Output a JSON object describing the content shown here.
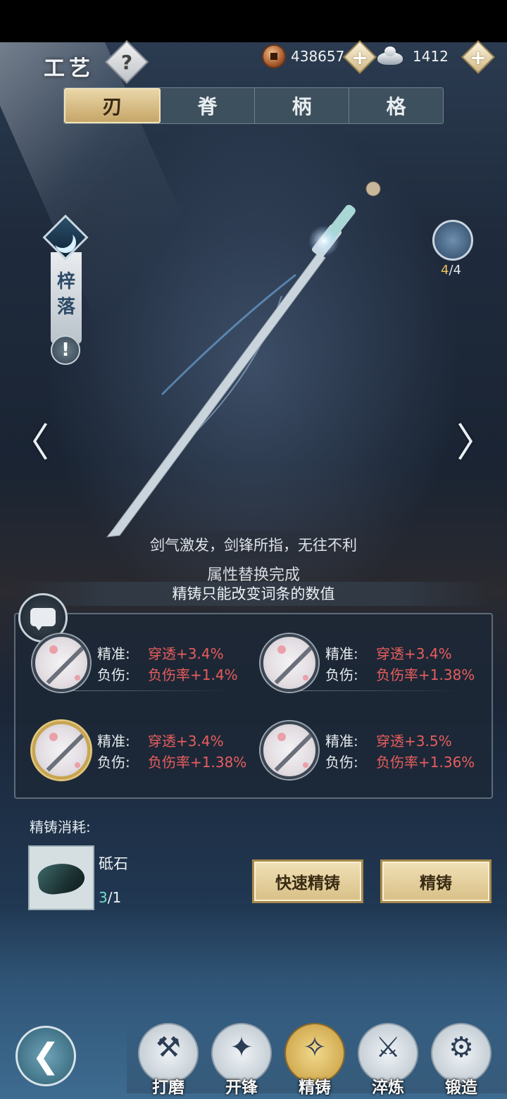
{
  "header": {
    "title": "工艺",
    "help_symbol": "?",
    "copper": "438657",
    "silver": "1412",
    "plus_symbol": "+"
  },
  "tabs": [
    {
      "label": "刃",
      "active": true
    },
    {
      "label": "脊",
      "active": false
    },
    {
      "label": "柄",
      "active": false
    },
    {
      "label": "格",
      "active": false
    }
  ],
  "weapon": {
    "badge_name": "梓落",
    "warn_symbol": "!",
    "skill_current": "4",
    "skill_total": "/4",
    "prev_arrow": "〈",
    "next_arrow": "〉",
    "flavor_text": "剑气激发，剑锋所指，无往不利",
    "status_text": "属性替换完成"
  },
  "hint": "精铸只能改变词条的数值",
  "attributes": [
    {
      "label1": "精准:",
      "value1": "穿透+3.4%",
      "label2": "负伤:",
      "value2": "负伤率+1.4%",
      "selected": false
    },
    {
      "label1": "精准:",
      "value1": "穿透+3.4%",
      "label2": "负伤:",
      "value2": "负伤率+1.38%",
      "selected": false
    },
    {
      "label1": "精准:",
      "value1": "穿透+3.4%",
      "label2": "负伤:",
      "value2": "负伤率+1.38%",
      "selected": true
    },
    {
      "label1": "精准:",
      "value1": "穿透+3.5%",
      "label2": "负伤:",
      "value2": "负伤率+1.36%",
      "selected": false
    }
  ],
  "cost": {
    "title": "精铸消耗:",
    "material_name": "砥石",
    "have": "3",
    "need": "/1"
  },
  "actions": {
    "quick_label": "快速精铸",
    "main_label": "精铸"
  },
  "nav": {
    "back_symbol": "❮",
    "items": [
      {
        "label": "打磨",
        "icon": "sharpen-icon",
        "glyph": "⚒"
      },
      {
        "label": "开锋",
        "icon": "edge-icon",
        "glyph": "✦"
      },
      {
        "label": "精铸",
        "icon": "refine-icon",
        "glyph": "✧"
      },
      {
        "label": "淬炼",
        "icon": "temper-icon",
        "glyph": "⚔"
      },
      {
        "label": "锻造",
        "icon": "forge-icon",
        "glyph": "⚙"
      }
    ],
    "active_index": 2
  },
  "colors": {
    "accent_gold": "#d8bf86",
    "value_red": "#e85d5d",
    "have_green": "#6fe0c7"
  }
}
